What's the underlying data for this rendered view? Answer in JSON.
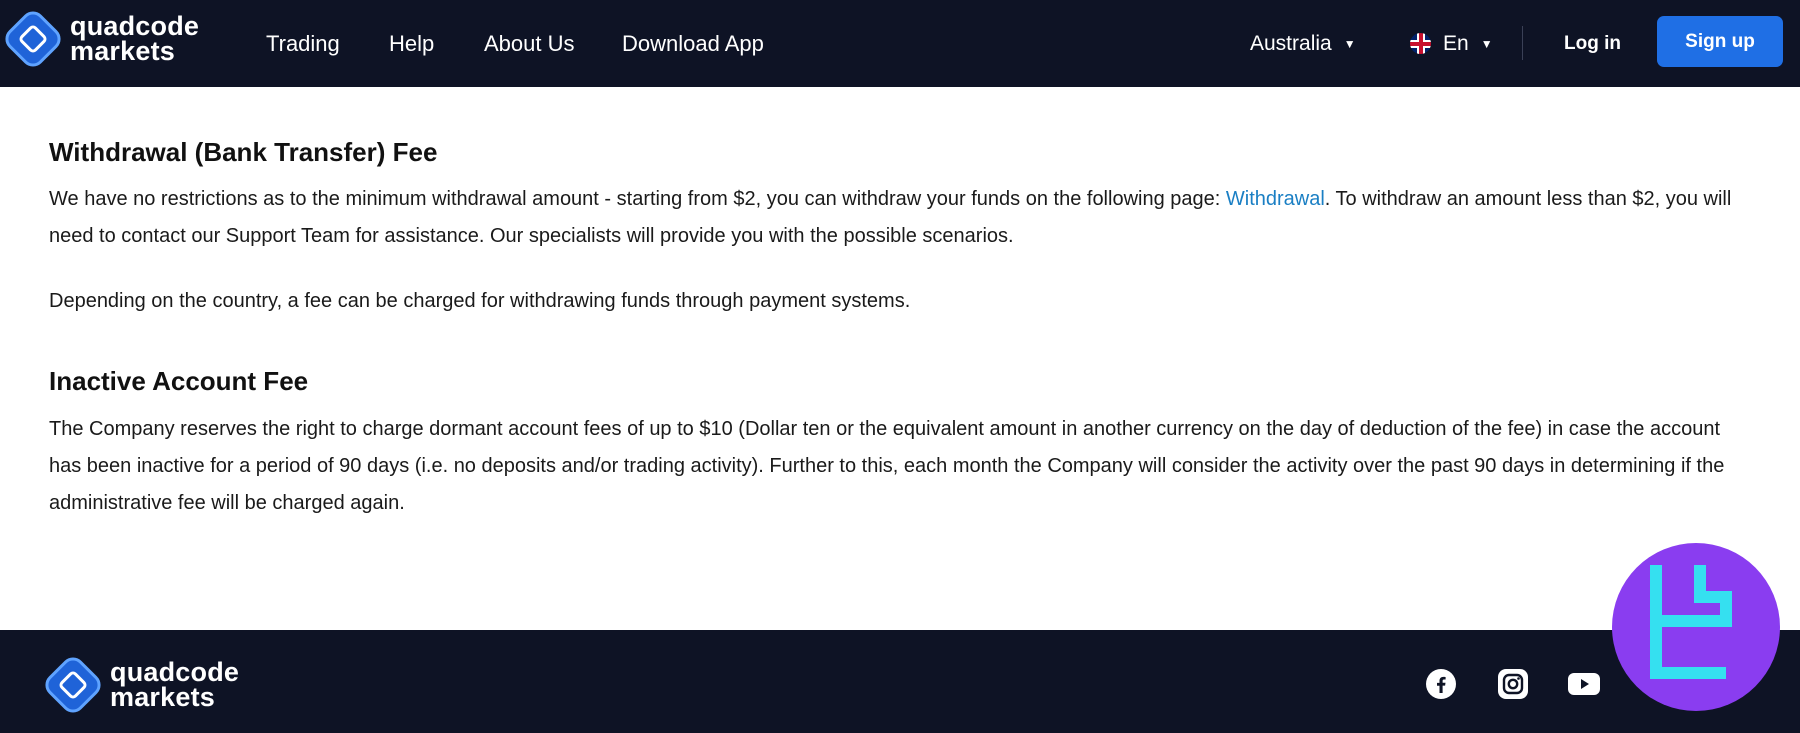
{
  "brand": {
    "line1": "quadcode",
    "line2": "markets"
  },
  "nav": {
    "trading": "Trading",
    "help": "Help",
    "about": "About Us",
    "download": "Download App"
  },
  "header": {
    "region": "Australia",
    "language": "En",
    "login": "Log in",
    "signup": "Sign up"
  },
  "sections": {
    "withdrawal": {
      "title": "Withdrawal (Bank Transfer) Fee",
      "p1_before": "We have no restrictions as to the minimum withdrawal amount - starting from $2, you can withdraw your funds on the following page: ",
      "p1_link": "Withdrawal",
      "p1_after": ". To withdraw an amount less than $2, you will need to contact our Support Team for assistance. Our specialists will provide you with the possible scenarios.",
      "p2": "Depending on the country, a fee can be charged for withdrawing funds through payment systems."
    },
    "inactive": {
      "title": "Inactive Account Fee",
      "p1": "The Company reserves the right to charge dormant account fees of up to $10 (Dollar ten or the equivalent amount in another currency on the day of deduction of the fee) in case the account has been inactive for a period of 90 days (i.e. no deposits and/or trading activity). Further to this, each month the Company will consider the activity over the past 90 days in determining if the administrative fee will be charged again."
    }
  },
  "footer": {
    "social": [
      "facebook-icon",
      "instagram-icon",
      "youtube-icon"
    ]
  },
  "colors": {
    "header_bg": "#0e1325",
    "accent": "#1f6fe5",
    "link": "#1a7fc4",
    "badge": "#8a3df0",
    "badge_mark": "#35e0f0"
  }
}
